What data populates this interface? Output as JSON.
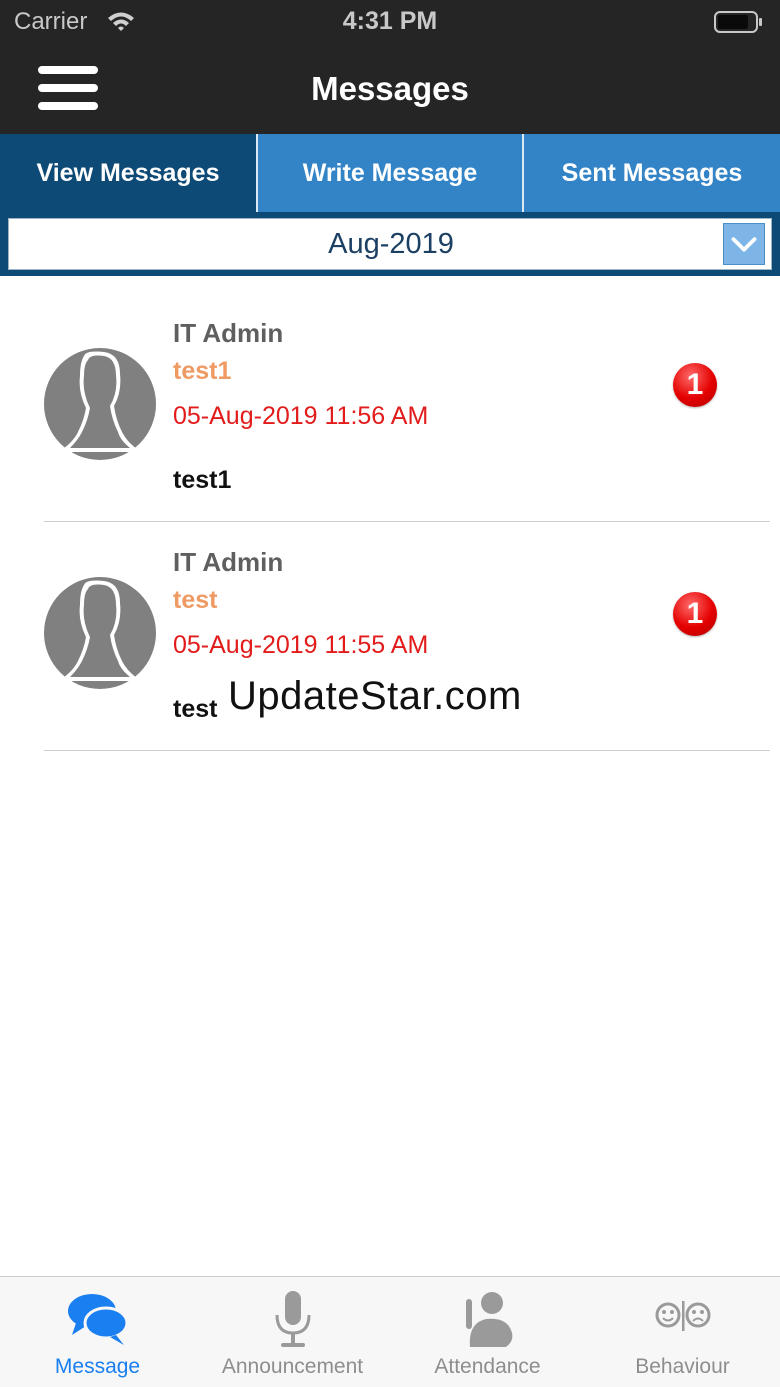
{
  "status_bar": {
    "carrier": "Carrier",
    "time": "4:31 PM"
  },
  "nav_bar": {
    "title": "Messages"
  },
  "tabs": [
    {
      "label": "View Messages",
      "active": true
    },
    {
      "label": "Write Message",
      "active": false
    },
    {
      "label": "Sent Messages",
      "active": false
    }
  ],
  "month_filter": {
    "selected": "Aug-2019"
  },
  "messages": [
    {
      "sender": "IT Admin",
      "subject": "test1",
      "datetime": "05-Aug-2019 11:56 AM",
      "body": "test1",
      "unread": "1"
    },
    {
      "sender": "IT Admin",
      "subject": "test",
      "datetime": "05-Aug-2019 11:55 AM",
      "body": "test",
      "unread": "1"
    }
  ],
  "watermark": "UpdateStar.com",
  "bottom_tabs": [
    {
      "label": "Message",
      "icon": "chat-bubbles-icon",
      "active": true
    },
    {
      "label": "Announcement",
      "icon": "microphone-icon",
      "active": false
    },
    {
      "label": "Attendance",
      "icon": "attendance-person-icon",
      "active": false
    },
    {
      "label": "Behaviour",
      "icon": "smiley-frown-icon",
      "active": false
    }
  ],
  "colors": {
    "header_bg": "#252525",
    "tab_active": "#0e4a76",
    "tab_inactive": "#3384c7",
    "subject": "#ee9a62",
    "datetime": "#e21b1b",
    "badge": "#e40000",
    "bottom_active": "#1a7ff0",
    "bottom_inactive": "#8e8e8e"
  }
}
